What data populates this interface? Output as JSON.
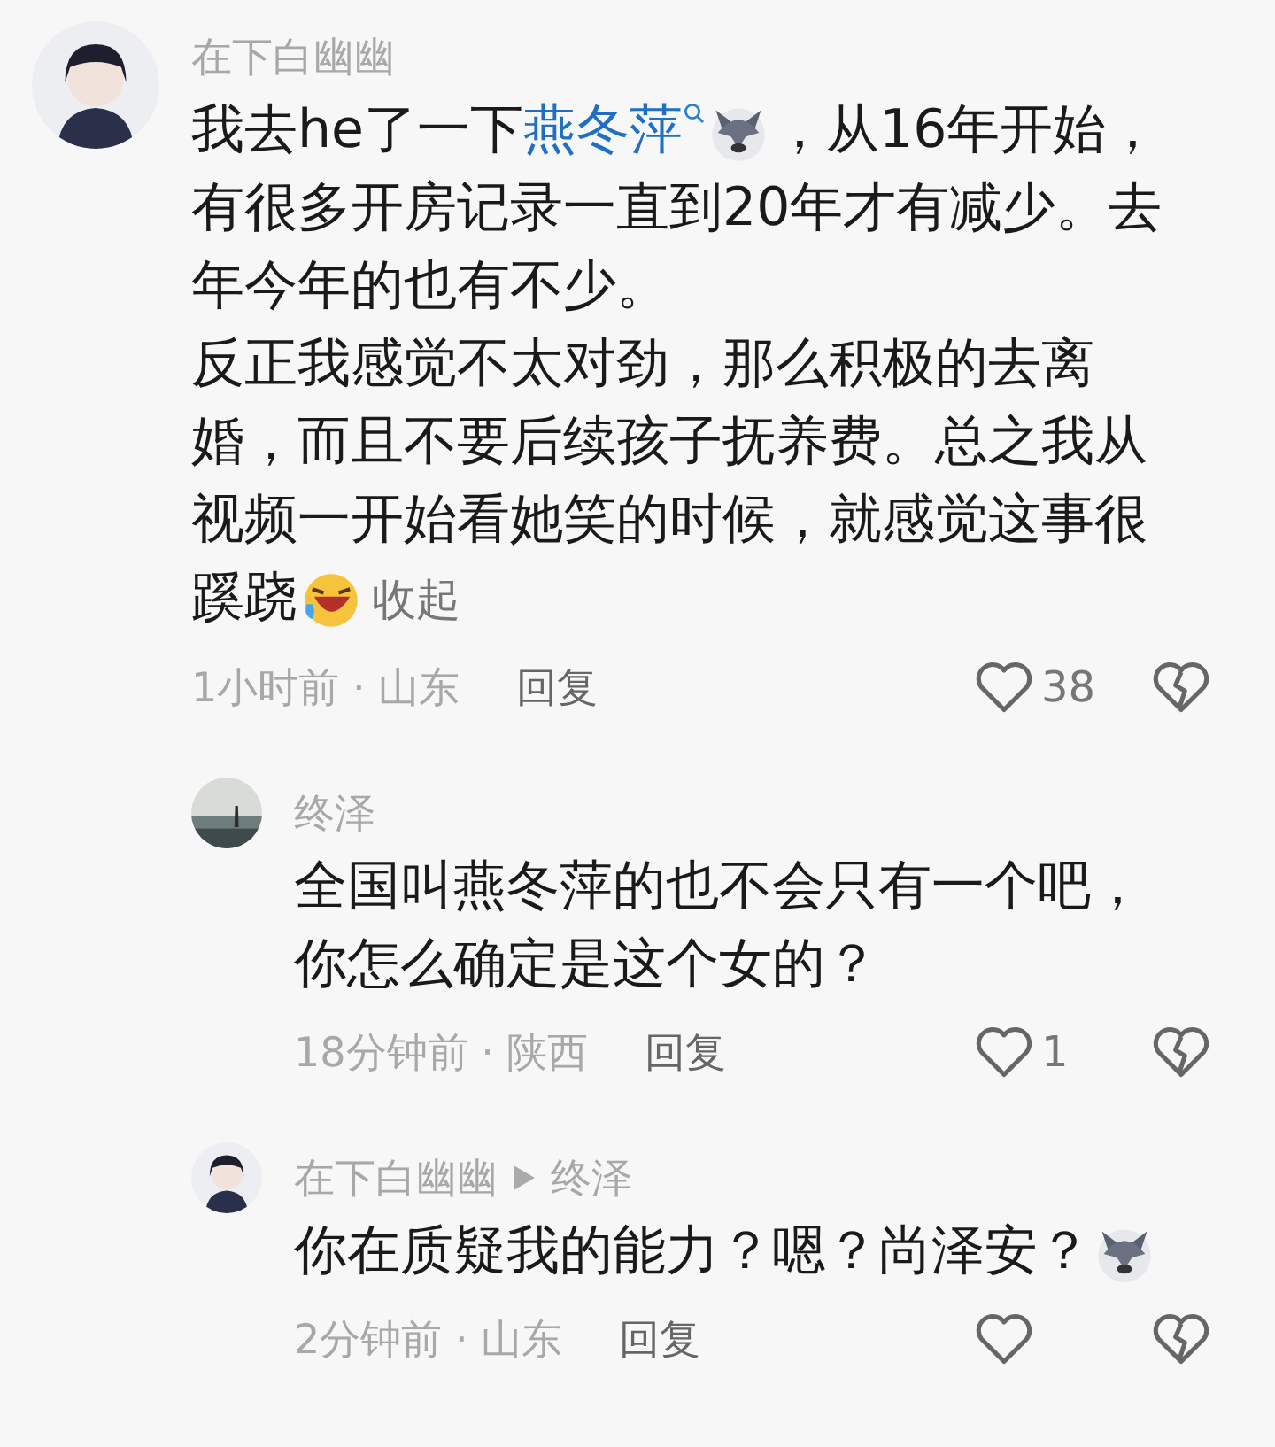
{
  "comments": [
    {
      "kind": "top",
      "author": "在下白幽幽",
      "avatar": {
        "kind": "anime"
      },
      "paragraphs": [
        [
          {
            "kind": "text",
            "text": "我去he了一下"
          },
          {
            "kind": "link",
            "text": "燕冬萍"
          },
          {
            "kind": "dog"
          },
          {
            "kind": "text",
            "text": "，从16年开始，有很多开房记录一直到20年才有减少。去年今年的也有不少。"
          }
        ],
        [
          {
            "kind": "text",
            "text": "反正我感觉不太对劲，那么积极的去离婚，而且不要后续孩子抚养费。总之我从视频一开始看她笑的时候，就感觉这事很蹊跷"
          },
          {
            "kind": "laugh"
          },
          {
            "kind": "collapse",
            "text": "收起"
          }
        ]
      ],
      "time": "1小时前 · 山东",
      "reply": "回复",
      "likes": "38"
    },
    {
      "kind": "reply",
      "author": "终泽",
      "avatar": {
        "kind": "landscape"
      },
      "paragraphs": [
        [
          {
            "kind": "text",
            "text": "全国叫燕冬萍的也不会只有一个吧，你怎么确定是这个女的？"
          }
        ]
      ],
      "time": "18分钟前 · 陕西",
      "reply": "回复",
      "likes": "1"
    },
    {
      "kind": "reply",
      "author": "在下白幽幽",
      "reply_to": "终泽",
      "avatar": {
        "kind": "anime"
      },
      "paragraphs": [
        [
          {
            "kind": "text",
            "text": "你在质疑我的能力？嗯？尚泽安？"
          },
          {
            "kind": "dog"
          }
        ]
      ],
      "time": "2分钟前 · 山东",
      "reply": "回复"
    }
  ]
}
